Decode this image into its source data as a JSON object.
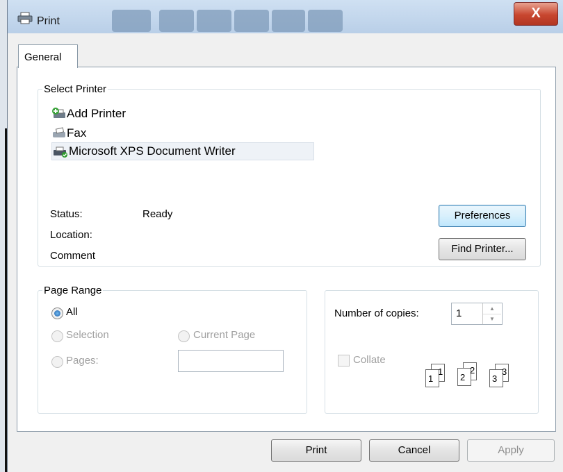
{
  "window": {
    "title": "Print",
    "close_label": "X"
  },
  "tabs": [
    {
      "label": "General",
      "active": true
    }
  ],
  "select_printer": {
    "legend": "Select Printer",
    "printers": [
      {
        "name": "Add Printer",
        "icon": "add-printer-icon",
        "selected": false
      },
      {
        "name": "Fax",
        "icon": "fax-icon",
        "selected": false
      },
      {
        "name": "Microsoft XPS Document Writer",
        "icon": "xps-printer-icon",
        "selected": true
      }
    ],
    "status_label": "Status:",
    "status_value": "Ready",
    "location_label": "Location:",
    "location_value": "",
    "comment_label": "Comment",
    "comment_value": "",
    "preferences_label": "Preferences",
    "find_printer_label": "Find Printer..."
  },
  "page_range": {
    "legend": "Page Range",
    "options": {
      "all": {
        "label": "All",
        "checked": true,
        "enabled": true
      },
      "selection": {
        "label": "Selection",
        "checked": false,
        "enabled": false
      },
      "current_page": {
        "label": "Current Page",
        "checked": false,
        "enabled": false
      },
      "pages": {
        "label": "Pages:",
        "checked": false,
        "enabled": false
      }
    },
    "pages_value": ""
  },
  "copies": {
    "label": "Number of copies:",
    "value": "1",
    "collate_label": "Collate",
    "collate_checked": false,
    "collate_enabled": false,
    "collate_pages": [
      {
        "a": "1",
        "b": "1"
      },
      {
        "a": "2",
        "b": "2"
      },
      {
        "a": "3",
        "b": "3"
      }
    ]
  },
  "buttons": {
    "print": "Print",
    "cancel": "Cancel",
    "apply": "Apply"
  },
  "colors": {
    "titlebar": "#b9cfe8",
    "close_button": "#c8462f",
    "default_button": "#bee6fd"
  }
}
